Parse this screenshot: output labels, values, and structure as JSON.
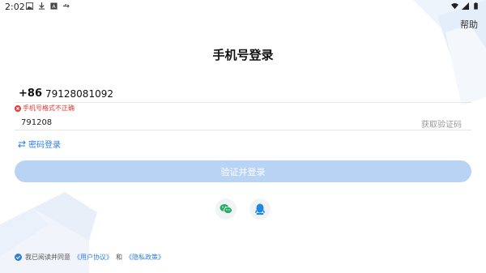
{
  "status_bar": {
    "time": "2:02"
  },
  "header": {
    "help_label": "帮助",
    "title": "手机号登录"
  },
  "phone": {
    "country_code": "+86",
    "value": "79128081092"
  },
  "error": {
    "message": "手机号格式不正确"
  },
  "code": {
    "value": "791208",
    "get_code_label": "获取验证码"
  },
  "password_login_label": "密码登录",
  "submit_label": "验证并登录",
  "social": [
    "wechat-icon",
    "qq-icon"
  ],
  "agreement": {
    "prefix": "我已阅读并同意",
    "user_agreement": "《用户协议》",
    "and": "和",
    "privacy_policy": "《隐私政策》"
  },
  "colors": {
    "accent": "#2f7de1",
    "button_disabled": "#b9d3f5",
    "error": "#e53935",
    "wechat": "#2aae67",
    "qq": "#1e88e5"
  }
}
